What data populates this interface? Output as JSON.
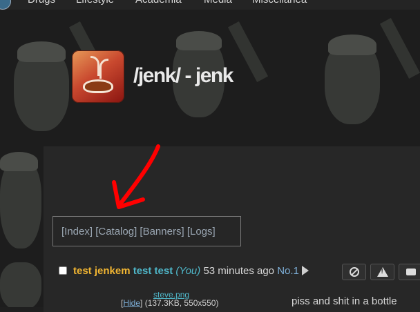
{
  "nav": {
    "links": [
      "Drugs",
      "Lifestyle",
      "Academia",
      "Media",
      "Miscellanea"
    ]
  },
  "board": {
    "title": "/jenk/ - jenk"
  },
  "board_nav": {
    "index": "[Index]",
    "catalog": "[Catalog]",
    "banners": "[Banners]",
    "logs": "[Logs]"
  },
  "post": {
    "subject": "test jenkem",
    "name": "test test",
    "you": "(You)",
    "time": "53 minutes ago",
    "number": "No.1",
    "body": "piss and shit in a bottle",
    "file": {
      "name": "steve.png",
      "hide_label": "Hide",
      "info": "(137.3KB, 550x550)"
    }
  },
  "colors": {
    "subject": "#f2b632",
    "name": "#4fb7c9",
    "link": "#7eb0d9",
    "annotation": "#ff0000"
  },
  "icons": [
    "site-logo-icon",
    "board-logo-icon",
    "play-icon",
    "ban-icon",
    "warning-icon",
    "message-icon"
  ]
}
